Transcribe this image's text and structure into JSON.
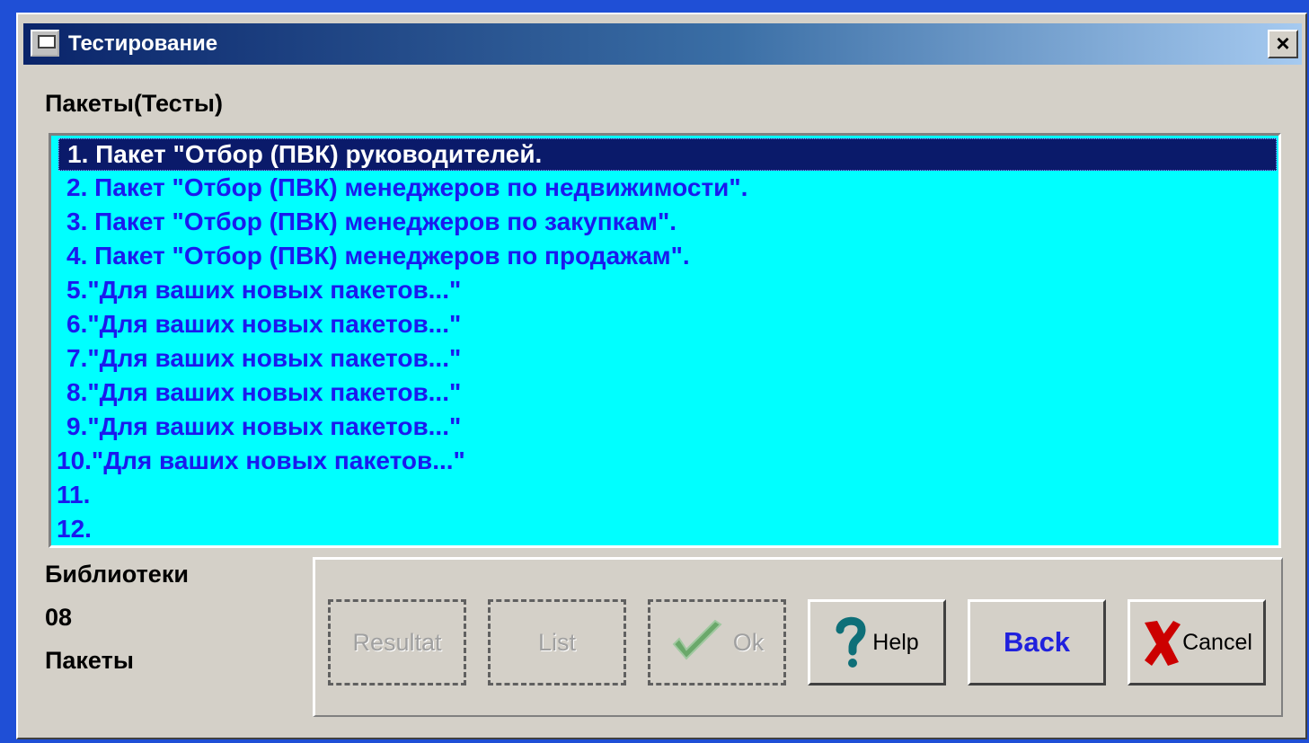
{
  "window": {
    "title": "Тестирование",
    "close_glyph": "×"
  },
  "packages": {
    "label": "Пакеты(Тесты)",
    "items": [
      "1. Пакет \"Отбор (ПВК) руководителей.",
      "2. Пакет \"Отбор (ПВК) менеджеров по недвижимости\".",
      "3. Пакет \"Отбор (ПВК) менеджеров по закупкам\".",
      "4. Пакет \"Отбор (ПВК) менеджеров по продажам\".",
      "5.\"Для ваших новых пакетов...\"",
      "6.\"Для ваших новых пакетов...\"",
      "7.\"Для ваших новых пакетов...\"",
      "8.\"Для ваших новых пакетов...\"",
      "9.\"Для ваших новых пакетов...\"",
      "10.\"Для ваших новых пакетов...\"",
      "11.",
      "12."
    ],
    "selected_index": 0
  },
  "info": {
    "libraries_label": "Библиотеки",
    "count": "08",
    "packages_label": "Пакеты"
  },
  "buttons": {
    "result": "Resultat",
    "list": "List",
    "ok": "Ok",
    "help": "Help",
    "back": "Back",
    "cancel": "Cancel"
  },
  "colors": {
    "desktop": "#1f4fd6",
    "listbox_bg": "#00ffff",
    "list_text": "#1a1aee",
    "selected_bg": "#0a1a6a",
    "ok_icon": "#2e9e2e",
    "help_icon": "#0e6f78",
    "cancel_icon": "#cc0000"
  },
  "icons": {
    "system": "window-icon",
    "ok": "checkmark-icon",
    "help": "question-mark-icon",
    "cancel": "red-x-icon"
  }
}
